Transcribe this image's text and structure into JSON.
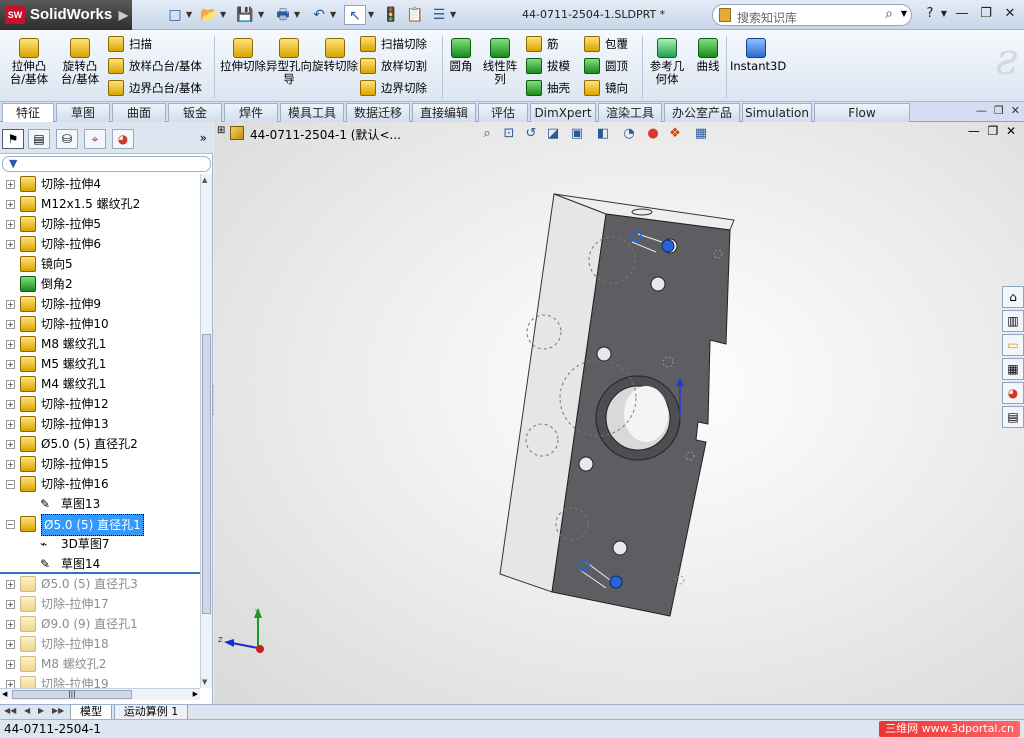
{
  "app": {
    "logo_text": "SolidWorks",
    "logo_badge": "SW"
  },
  "titlebar": {
    "doc_title": "44-0711-2504-1.SLDPRT *",
    "search_placeholder": "搜索知识库",
    "help": "?",
    "minimize": "—",
    "restore": "❐",
    "close": "✕"
  },
  "ribbon": {
    "extrude_boss": "拉伸凸台/基体",
    "revolve_boss": "旋转凸台/基体",
    "sweep": "扫描",
    "loft": "放样凸台/基体",
    "boundary": "边界凸台/基体",
    "extrude_cut": "拉伸切除",
    "hole_wizard": "异型孔向导",
    "revolve_cut": "旋转切除",
    "swept_cut": "扫描切除",
    "lofted_cut": "放样切割",
    "boundary_cut": "边界切除",
    "fillet": "圆角",
    "linear_pattern": "线性阵列",
    "rib": "筋",
    "draft": "拔模",
    "shell": "抽壳",
    "wrap": "包覆",
    "dome": "圆顶",
    "mirror": "镜向",
    "ref_geometry": "参考几何体",
    "curves": "曲线",
    "instant3d": "Instant3D"
  },
  "tabs": [
    "特征",
    "草图",
    "曲面",
    "钣金",
    "焊件",
    "模具工具",
    "数据迁移",
    "直接编辑",
    "评估",
    "DimXpert",
    "渲染工具",
    "办公室产品",
    "Simulation",
    "Flow Simulation"
  ],
  "tree": {
    "items": [
      {
        "label": "切除-拉伸4",
        "type": "cut"
      },
      {
        "label": "M12x1.5 螺纹孔2",
        "type": "hole"
      },
      {
        "label": "切除-拉伸5",
        "type": "cut"
      },
      {
        "label": "切除-拉伸6",
        "type": "cut"
      },
      {
        "label": "镜向5",
        "type": "mirror"
      },
      {
        "label": "倒角2",
        "type": "chamfer"
      },
      {
        "label": "切除-拉伸9",
        "type": "cut"
      },
      {
        "label": "切除-拉伸10",
        "type": "cut"
      },
      {
        "label": "M8 螺纹孔1",
        "type": "hole"
      },
      {
        "label": "M5 螺纹孔1",
        "type": "hole"
      },
      {
        "label": "M4 螺纹孔1",
        "type": "hole"
      },
      {
        "label": "切除-拉伸12",
        "type": "cut"
      },
      {
        "label": "切除-拉伸13",
        "type": "cut"
      },
      {
        "label": "Ø5.0 (5) 直径孔2",
        "type": "hole"
      },
      {
        "label": "切除-拉伸15",
        "type": "cut"
      },
      {
        "label": "切除-拉伸16",
        "type": "cut"
      },
      {
        "label": "草图13",
        "type": "sketch"
      },
      {
        "label": "Ø5.0 (5) 直径孔1",
        "type": "hole"
      },
      {
        "label": "3D草图7",
        "type": "sketch3d"
      },
      {
        "label": "草图14",
        "type": "sketch"
      },
      {
        "label": "Ø5.0 (5) 直径孔3",
        "type": "hole"
      },
      {
        "label": "切除-拉伸17",
        "type": "cut"
      },
      {
        "label": "Ø9.0 (9) 直径孔1",
        "type": "hole"
      },
      {
        "label": "切除-拉伸18",
        "type": "cut"
      },
      {
        "label": "M8 螺纹孔2",
        "type": "hole"
      },
      {
        "label": "切除-拉伸19",
        "type": "cut"
      }
    ]
  },
  "viewport": {
    "doc_label": "44-0711-2504-1 (默认<..."
  },
  "bottom_tabs": [
    "模型",
    "运动算例 1"
  ],
  "status": {
    "filename": "44-0711-2504-1",
    "watermark": "三维网 www.3dportal.cn"
  },
  "colors": {
    "accent": "#3399ff",
    "selection": "#3399ff",
    "part_face": "#5e5e62",
    "brand": "#c8102e"
  }
}
